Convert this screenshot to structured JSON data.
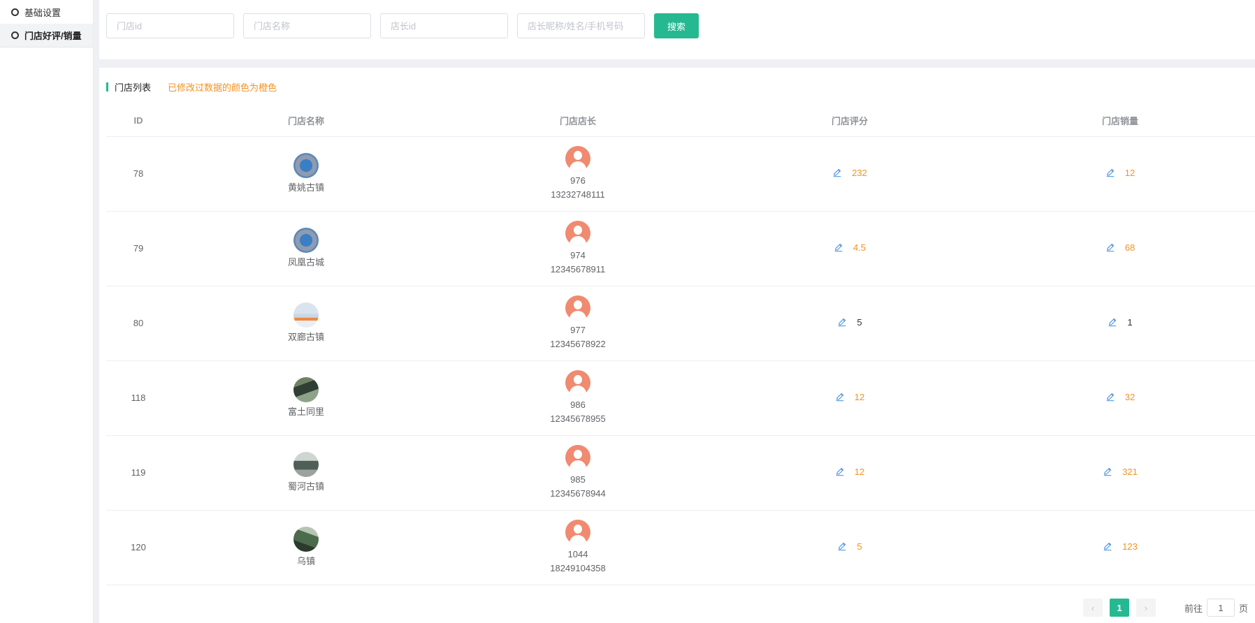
{
  "sidebar": {
    "items": [
      {
        "label": "基础设置"
      },
      {
        "label": "门店好评/销量"
      }
    ]
  },
  "search": {
    "store_id_placeholder": "门店id",
    "store_name_placeholder": "门店名称",
    "manager_id_placeholder": "店长id",
    "manager_info_placeholder": "店长昵称/姓名/手机号码",
    "button_label": "搜索"
  },
  "list": {
    "title": "门店列表",
    "note": "已修改过数据的颜色为橙色",
    "columns": [
      "ID",
      "门店名称",
      "门店店长",
      "门店评分",
      "门店销量"
    ],
    "rows": [
      {
        "id": "78",
        "store_name": "黄姚古镇",
        "manager_id": "976",
        "manager_phone": "13232748111",
        "rating": "232",
        "rating_modified": true,
        "sales": "12",
        "sales_modified": true
      },
      {
        "id": "79",
        "store_name": "凤凰古城",
        "manager_id": "974",
        "manager_phone": "12345678911",
        "rating": "4.5",
        "rating_modified": true,
        "sales": "68",
        "sales_modified": true
      },
      {
        "id": "80",
        "store_name": "双廊古镇",
        "manager_id": "977",
        "manager_phone": "12345678922",
        "rating": "5",
        "rating_modified": false,
        "sales": "1",
        "sales_modified": false
      },
      {
        "id": "118",
        "store_name": "富土同里",
        "manager_id": "986",
        "manager_phone": "12345678955",
        "rating": "12",
        "rating_modified": true,
        "sales": "32",
        "sales_modified": true
      },
      {
        "id": "119",
        "store_name": "蜀河古镇",
        "manager_id": "985",
        "manager_phone": "12345678944",
        "rating": "12",
        "rating_modified": true,
        "sales": "321",
        "sales_modified": true
      },
      {
        "id": "120",
        "store_name": "乌镇",
        "manager_id": "1044",
        "manager_phone": "18249104358",
        "rating": "5",
        "rating_modified": true,
        "sales": "123",
        "sales_modified": true
      }
    ]
  },
  "pagination": {
    "prev": "‹",
    "current": "1",
    "next": "›",
    "goto_prefix": "前往",
    "goto_value": "1",
    "goto_suffix": "页"
  },
  "colors": {
    "accent": "#26b991",
    "modified": "#f5911e",
    "edit_icon": "#4a90e2"
  }
}
